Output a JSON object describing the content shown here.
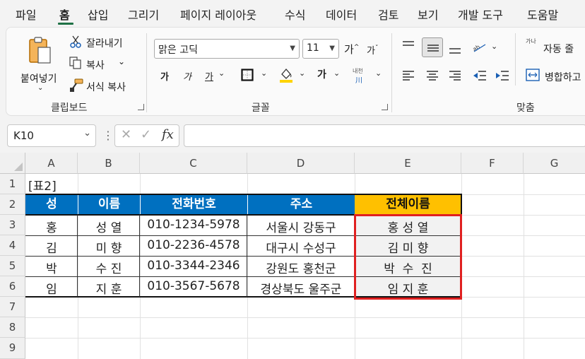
{
  "menu": {
    "items": [
      "파일",
      "홈",
      "삽입",
      "그리기",
      "페이지 레이아웃",
      "수식",
      "데이터",
      "검토",
      "보기",
      "개발 도구",
      "도움말"
    ],
    "active": "홈"
  },
  "ribbon": {
    "clipboard": {
      "paste_label": "붙여넣기",
      "cut_label": "잘라내기",
      "copy_label": "복사",
      "format_painter_label": "서식 복사",
      "group_label": "클립보드"
    },
    "font": {
      "font_name": "맑은 고딕",
      "font_size": "11",
      "bold": "가",
      "italic": "가",
      "underline": "가",
      "font_color_glyph": "가",
      "phonetic_top": "내천",
      "phonetic_bottom": "川",
      "grow": "가",
      "shrink": "가",
      "group_label": "글꼴"
    },
    "alignment": {
      "wrap_label": "자동 줄",
      "merge_label": "병합하고",
      "wrap_glyph": "가나",
      "group_label": "맞춤"
    }
  },
  "formula_bar": {
    "name_box": "K10",
    "fx": "fx",
    "formula": ""
  },
  "sheet": {
    "columns": [
      "A",
      "B",
      "C",
      "D",
      "E",
      "F",
      "G"
    ],
    "rows": [
      "1",
      "2",
      "3",
      "4",
      "5",
      "6",
      "7",
      "8",
      "9"
    ],
    "table_title": "[표2]",
    "headers": [
      "성",
      "이름",
      "전화번호",
      "주소",
      "전체이름"
    ],
    "data": [
      [
        "홍",
        "성 열",
        "010-1234-5978",
        "서울시 강동구",
        "홍 성 열"
      ],
      [
        "김",
        "미 향",
        "010-2236-4578",
        "대구시 수성구",
        "김 미 향"
      ],
      [
        "박",
        "수 진",
        "010-3344-2346",
        "강원도 홍천군",
        "박  수  진"
      ],
      [
        "임",
        "지 훈",
        "010-3567-5678",
        "경상북도 울주군",
        "임 지 훈"
      ]
    ]
  },
  "colors": {
    "header_blue": "#0070c0",
    "header_gold": "#ffc000",
    "highlight_red": "#e02020",
    "fill_gray": "#f2f2f2",
    "excel_green": "#1e7145"
  }
}
